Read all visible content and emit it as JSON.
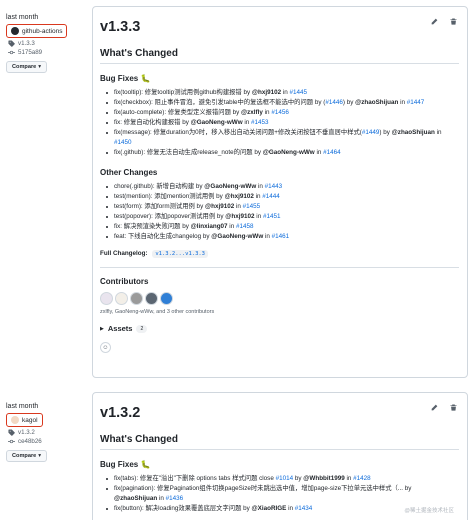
{
  "release1": {
    "date": "last month",
    "author": "github-actions",
    "tag": "v1.3.3",
    "commit": "5175a89",
    "compare_label": "Compare",
    "title": "v1.3.3",
    "whats_changed": "What's Changed",
    "bug_fixes_heading": "Bug Fixes 🐛",
    "bug_fixes": [
      {
        "text": "fix(tooltip): 修复tooltip测试用例github构建报错 by ",
        "who": "@hxj9102",
        "mid": " in ",
        "pr": "#1445"
      },
      {
        "text": "fix(checkbox): 阻止事件冒泡，避免引发table中的复选框不能选中的问题 by ",
        "who": "@zhaoShijuan",
        "mid": " in ",
        "pr": "#1447",
        "pre_pr": "#1446"
      },
      {
        "text": "fix(auto-complete): 修复类型定义报错问题 by ",
        "who": "@zxlfly",
        "mid": " in ",
        "pr": "#1456"
      },
      {
        "text": "fix: 修复自动化构建报错 by ",
        "who": "@GaoNeng-wWw",
        "mid": " in ",
        "pr": "#1453"
      },
      {
        "text": "fix(message): 修复duration为0时，移入移出自动关闭问题+修改关闭按钮不垂直居中样式(",
        "who": "@zhaoShijuan",
        "mid": " in ",
        "pr": "#1450",
        "pre_pr": "#1449"
      },
      {
        "text": "fix(.github): 修复无法自动生成release_note的问题 by ",
        "who": "@GaoNeng-wWw",
        "mid": " in ",
        "pr": "#1464"
      }
    ],
    "other_heading": "Other Changes",
    "other_changes": [
      {
        "text": "chore(.github): 新增自动构建 by ",
        "who": "@GaoNeng-wWw",
        "mid": " in ",
        "pr": "#1443"
      },
      {
        "text": "test(mention): 添加mention测试用例 by ",
        "who": "@hxj9102",
        "mid": " in ",
        "pr": "#1444"
      },
      {
        "text": "test(form): 添加form测试用例 by ",
        "who": "@hxj9102",
        "mid": " in ",
        "pr": "#1455"
      },
      {
        "text": "test(popover): 添加popover测试用例 by ",
        "who": "@hxj9102",
        "mid": " in ",
        "pr": "#1451"
      },
      {
        "text": "fix: 解决预渲染失败问题 by ",
        "who": "@linxiang07",
        "mid": " in ",
        "pr": "#1458"
      },
      {
        "text": "feat: 下线自动化生成changelog by ",
        "who": "@GaoNeng-wWw",
        "mid": " in ",
        "pr": "#1461"
      }
    ],
    "changelog_label": "Full Changelog:",
    "changelog_range": "v1.3.2...v1.3.3",
    "contributors_heading": "Contributors",
    "contributors_text": "zxlfly, GaoNeng-wWw, and 3 other contributors",
    "assets_label": "Assets",
    "assets_count": "2"
  },
  "release2": {
    "date": "last month",
    "author": "kagol",
    "tag": "v1.3.2",
    "commit": "ce48b26",
    "compare_label": "Compare",
    "title": "v1.3.2",
    "whats_changed": "What's Changed",
    "bug_fixes_heading": "Bug Fixes 🐛",
    "bug_fixes": [
      {
        "text": "fix(tabs): 修复在\"溢出\"下删除 options tabs 样式问题 close ",
        "link1": "#1014",
        "text2": " by ",
        "who": "@Whbbit1999",
        "mid": " in ",
        "pr": "#1428"
      },
      {
        "text": "fix(pagination): 修复Pagination组件切换pageSize时未跳出选中值，增加page-size下拉单元选中样式（... by ",
        "who": "",
        "mid": "",
        "pr": ""
      },
      {
        "text": "",
        "who": "@zhaoShijuan",
        "mid": " in ",
        "pr": "#1436"
      },
      {
        "text": "fix(button): 解决loading效果覆盖底层文字问题 by ",
        "who": "@XiaoRIGE",
        "mid": " in ",
        "pr": "#1434"
      }
    ]
  },
  "watermark": "@稀土掘金技术社区",
  "colors": {
    "link": "#0969da",
    "highlight_border": "#d9381e",
    "border": "#d0d7de"
  }
}
